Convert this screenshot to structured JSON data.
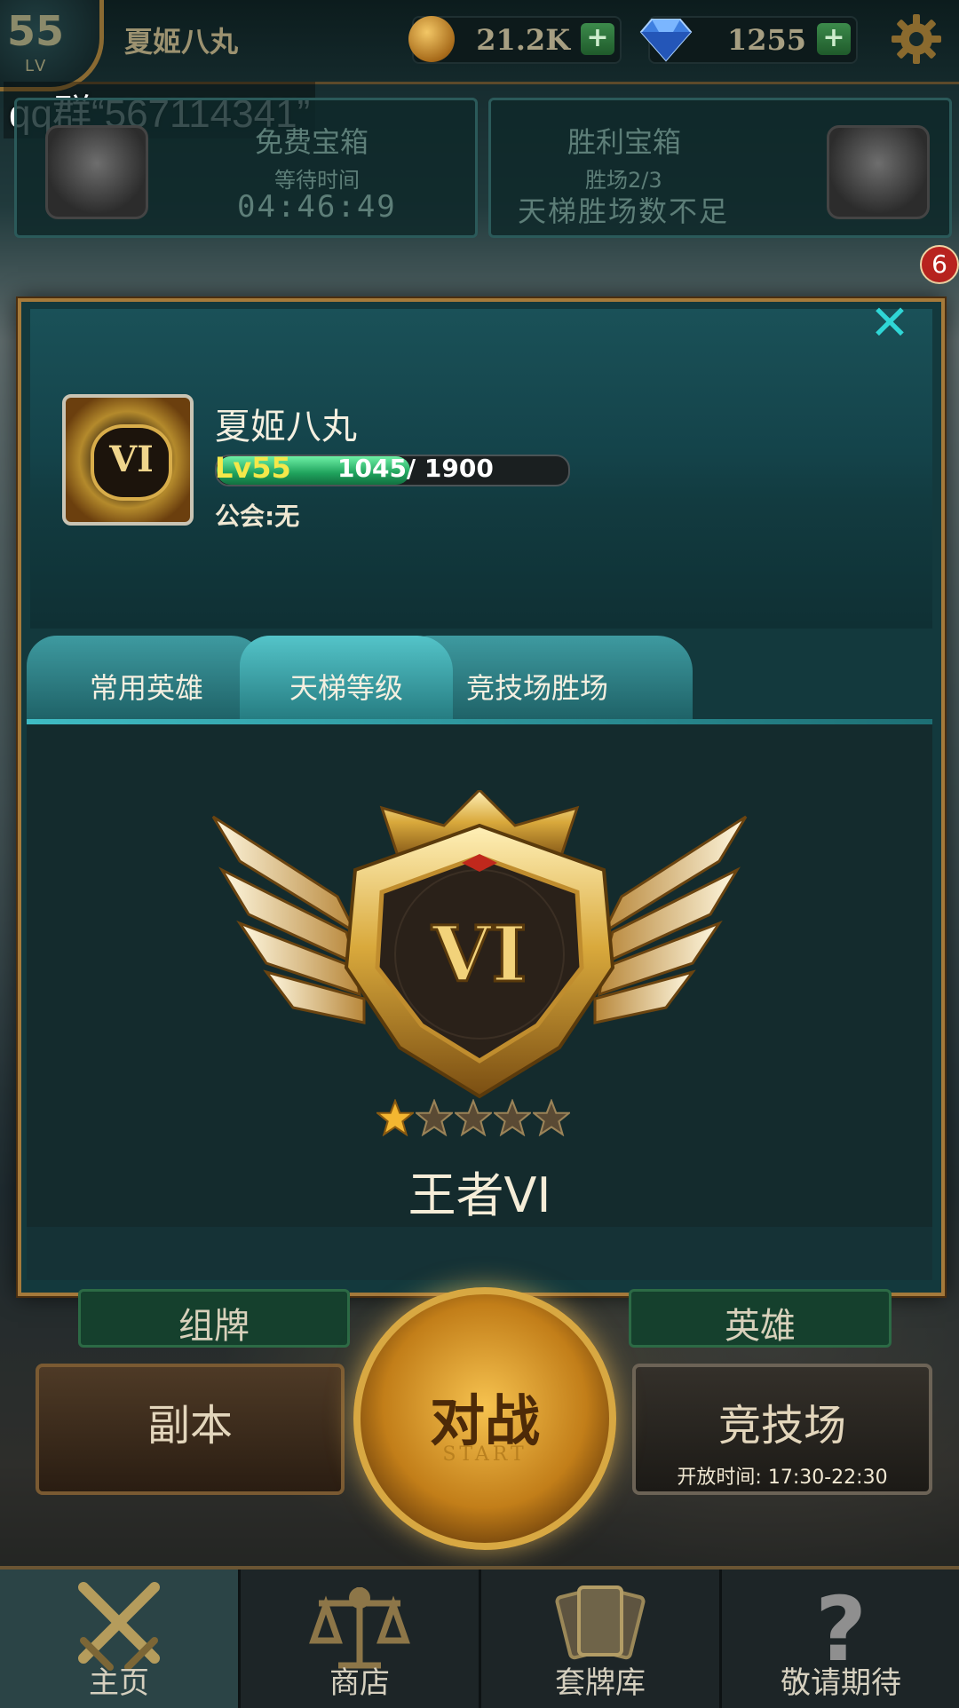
{
  "topbar": {
    "level": "55",
    "level_label": "LV",
    "player_name": "夏姬八丸",
    "gold": "21.2K",
    "gems": "1255"
  },
  "overlay_text": "qq群“567114341”",
  "chests": {
    "free": {
      "title": "免费宝箱",
      "subtitle": "等待时间",
      "timer": "04:46:49"
    },
    "victory": {
      "title": "胜利宝箱",
      "subtitle": "胜场2/3",
      "status": "天梯胜场数不足"
    }
  },
  "event_badge": "6",
  "profile": {
    "name": "夏姬八丸",
    "avatar_rank": "VI",
    "level_label": "Lv55",
    "xp_text": "1045/ 1900",
    "xp_current": 1045,
    "xp_max": 1900,
    "guild": "公会:无"
  },
  "tabs": [
    {
      "label": "常用英雄",
      "active": false
    },
    {
      "label": "天梯等级",
      "active": true
    },
    {
      "label": "竞技场胜场",
      "active": false
    }
  ],
  "ladder": {
    "emblem_numeral": "VI",
    "stars_filled": 1,
    "stars_total": 5,
    "rank_title": "王者VI"
  },
  "main_buttons": {
    "deck": "组牌",
    "heroes": "英雄",
    "dungeon": "副本",
    "battle": "对战",
    "battle_sub": "START",
    "arena": "竞技场",
    "arena_hours": "开放时间:  17:30-22:30"
  },
  "nav": [
    {
      "label": "主页",
      "icon": "swords-icon",
      "active": true
    },
    {
      "label": "商店",
      "icon": "scales-icon",
      "active": false
    },
    {
      "label": "套牌库",
      "icon": "cards-icon",
      "active": false
    },
    {
      "label": "敬请期待",
      "icon": "question-icon",
      "active": false
    }
  ],
  "colors": {
    "accent_teal": "#2fd6d6",
    "gold": "#d8a842",
    "xp_green": "#1fa25c",
    "level_yellow": "#f4e84a"
  }
}
